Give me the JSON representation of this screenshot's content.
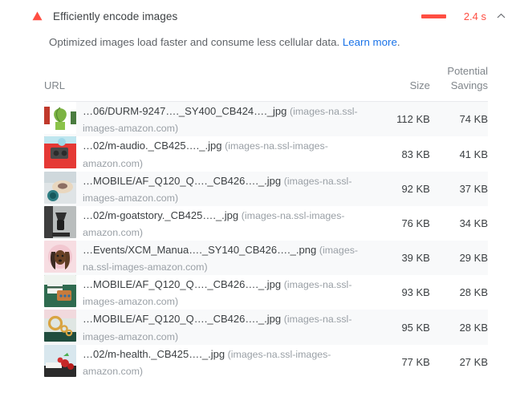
{
  "audit": {
    "icon": "warning-triangle-icon",
    "title": "Efficiently encode images",
    "score_bar_color": "#ff4e42",
    "time": "2.4 s",
    "collapse_icon": "chevron-up-icon",
    "description_before": "Optimized images load faster and consume less cellular data. ",
    "learn_more_label": "Learn more",
    "description_after": "."
  },
  "table": {
    "headers": {
      "url": "URL",
      "size": "Size",
      "savings_line1": "Potential",
      "savings_line2": "Savings"
    },
    "rows": [
      {
        "url": "…06/DURM-9247…._SY400_CB424…._jpg",
        "host": "(images-na.ssl-images-amazon.com)",
        "size": "112 KB",
        "savings": "74 KB",
        "thumb": "plant-thumbnail"
      },
      {
        "url": "…02/m-audio._CB425…._.jpg",
        "host": "(images-na.ssl-images-amazon.com)",
        "size": "83 KB",
        "savings": "41 KB",
        "thumb": "audio-gift-thumbnail"
      },
      {
        "url": "…MOBILE/AF_Q120_Q…._CB426…._.jpg",
        "host": "(images-na.ssl-images-amazon.com)",
        "size": "92 KB",
        "savings": "37 KB",
        "thumb": "watch-plate-thumbnail"
      },
      {
        "url": "…02/m-goatstory._CB425…._.jpg",
        "host": "(images-na.ssl-images-amazon.com)",
        "size": "76 KB",
        "savings": "34 KB",
        "thumb": "coffee-brewer-thumbnail"
      },
      {
        "url": "…Events/XCM_Manua…._SY140_CB426…._.png",
        "host": "(images-na.ssl-images-amazon.com)",
        "size": "39 KB",
        "savings": "29 KB",
        "thumb": "dog-thumbnail"
      },
      {
        "url": "…MOBILE/AF_Q120_Q…._CB426…._.jpg",
        "host": "(images-na.ssl-images-amazon.com)",
        "size": "93 KB",
        "savings": "28 KB",
        "thumb": "bag-thumbnail"
      },
      {
        "url": "…MOBILE/AF_Q120_Q…._CB426…._.jpg",
        "host": "(images-na.ssl-images-amazon.com)",
        "size": "95 KB",
        "savings": "28 KB",
        "thumb": "jewelry-thumbnail"
      },
      {
        "url": "…02/m-health._CB425…._.jpg",
        "host": "(images-na.ssl-images-amazon.com)",
        "size": "77 KB",
        "savings": "27 KB",
        "thumb": "health-berries-thumbnail"
      }
    ]
  }
}
